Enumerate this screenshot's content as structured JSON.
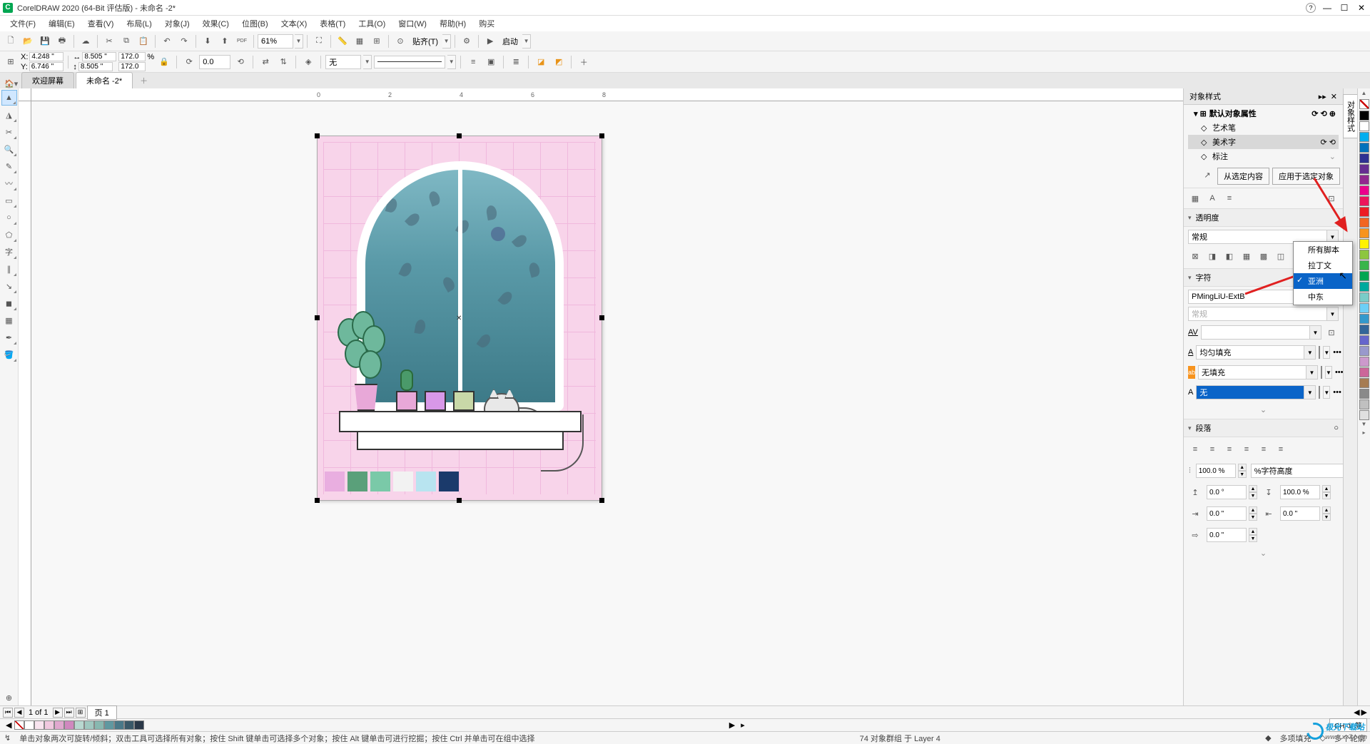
{
  "app": {
    "title": "CorelDRAW 2020 (64-Bit 评估版) - 未命名 -2*"
  },
  "menu": [
    "文件(F)",
    "编辑(E)",
    "查看(V)",
    "布局(L)",
    "对象(J)",
    "效果(C)",
    "位图(B)",
    "文本(X)",
    "表格(T)",
    "工具(O)",
    "窗口(W)",
    "帮助(H)",
    "购买"
  ],
  "toolbar1": {
    "zoom": "61%",
    "launch": "启动",
    "snap": "贴齐(T)"
  },
  "propbar": {
    "x": "4.248 \"",
    "y": "6.746 \"",
    "w": "8.505 \"",
    "h": "8.505 \"",
    "sx": "172.0",
    "sy": "172.0",
    "unit": "%",
    "rotate": "0.0",
    "outline": "无"
  },
  "tabs": {
    "welcome": "欢迎屏幕",
    "doc": "未命名 -2*"
  },
  "ruler_ticks": [
    "0",
    "2",
    "4",
    "6",
    "8"
  ],
  "swatches": [
    "#e9aee0",
    "#5aa07a",
    "#7ac9a8",
    "#f2f2f2",
    "#b8e4f0",
    "#1b3a6b"
  ],
  "docker": {
    "title": "对象样式",
    "tree": {
      "root": "默认对象属性",
      "items": [
        "艺术笔",
        "美术字",
        "标注"
      ]
    },
    "btn_from": "从选定内容",
    "btn_apply": "应用于选定对象",
    "transparency": {
      "title": "透明度",
      "mode": "常规"
    },
    "char": {
      "title": "字符",
      "font": "PMingLiU-ExtB",
      "style": "常规",
      "kerning_label": "AV",
      "fill_type": "均匀填充",
      "fill_none": "无填充",
      "outline_none": "无",
      "fill_color": "#000000",
      "outline_color": "#ff0000"
    },
    "script_menu": {
      "items": [
        "所有脚本",
        "拉丁文",
        "亚洲",
        "中东"
      ],
      "selected": "亚洲"
    },
    "paragraph": {
      "title": "段落",
      "line_spacing": "100.0 %",
      "line_unit": "%字符高度",
      "before": "0.0 °",
      "after": "100.0 %",
      "left_indent": "0.0 \"",
      "right_indent": "0.0 \"",
      "first_indent": "0.0 \""
    }
  },
  "vdock": {
    "tab1": "对象样式"
  },
  "palette": [
    "#000000",
    "#ffffff",
    "#00aeef",
    "#0072bc",
    "#2e3192",
    "#662d91",
    "#92278f",
    "#ec008c",
    "#ed145b",
    "#ed1c24",
    "#f26522",
    "#f7941d",
    "#fff200",
    "#8dc63f",
    "#39b54a",
    "#00a651",
    "#00a99d",
    "#7accc8",
    "#6dcff6",
    "#3399cc",
    "#336699",
    "#6666cc",
    "#9999cc",
    "#cc99cc",
    "#cc6699",
    "#a67c52",
    "#8a8a8a",
    "#c0c0c0",
    "#e0e0e0"
  ],
  "page_nav": {
    "page": "页 1"
  },
  "colorbar": [
    "#ffffff",
    "#f8e4ef",
    "#f0c8df",
    "#e0a8cf",
    "#d088bf",
    "#b8d8d0",
    "#a0c8c0",
    "#88b8b0",
    "#6098a0",
    "#4a7888",
    "#3a5868",
    "#2a3848"
  ],
  "lang": "CH ① 简",
  "status": {
    "hint": "单击对象两次可旋转/倾斜；双击工具可选择所有对象；按住 Shift 键单击可选择多个对象；按住 Alt 键单击可进行挖掘；按住 Ctrl 并单击可在组中选择",
    "selection": "74 对象群组 于 Layer 4",
    "fill": "多项填充",
    "outline": "多个轮廓"
  },
  "watermark": "极光下载站"
}
